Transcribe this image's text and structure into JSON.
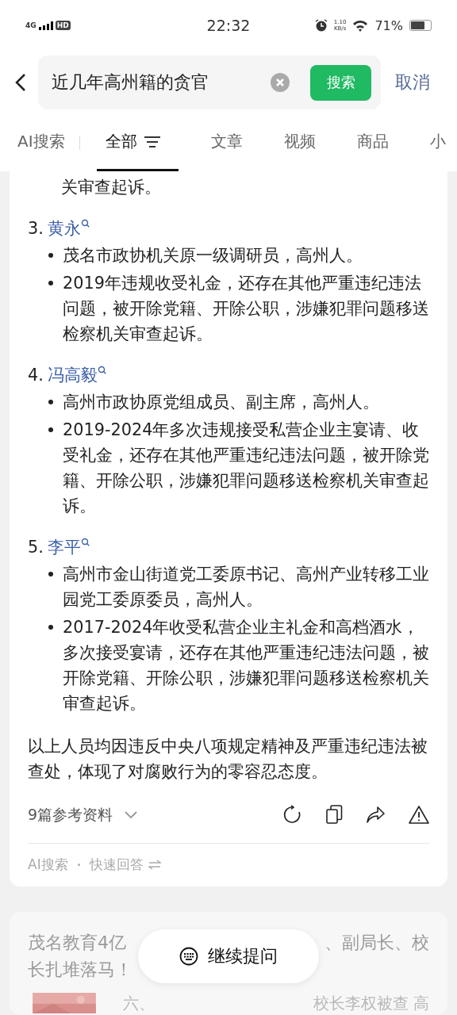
{
  "status_bar": {
    "network": "4G",
    "hd": "HD",
    "time": "22:32",
    "speed": "1.10",
    "speed_unit": "KB/s",
    "battery": "71%"
  },
  "search": {
    "query": "近几年高州籍的贪官",
    "button": "搜索",
    "cancel": "取消"
  },
  "tabs": [
    {
      "label": "AI搜索",
      "selected": false,
      "kind": "plain"
    },
    {
      "label": "全部",
      "selected": true,
      "kind": "filter"
    },
    {
      "label": "文章",
      "selected": false,
      "kind": "plain"
    },
    {
      "label": "视频",
      "selected": false,
      "kind": "plain"
    },
    {
      "label": "商品",
      "selected": false,
      "kind": "plain"
    },
    {
      "label": "小",
      "selected": false,
      "kind": "plain"
    }
  ],
  "answer": {
    "lead_text": "关审查起诉。",
    "items": [
      {
        "number": "3.",
        "name": "黄永",
        "bullets": [
          "茂名市政协机关原一级调研员，高州人。",
          "2019年违规收受礼金，还存在其他严重违纪违法问题，被开除党籍、开除公职，涉嫌犯罪问题移送检察机关审查起诉。"
        ]
      },
      {
        "number": "4.",
        "name": "冯高毅",
        "bullets": [
          "高州市政协原党组成员、副主席，高州人。",
          "2019-2024年多次违规接受私营企业主宴请、收受礼金，还存在其他严重违纪违法问题，被开除党籍、开除公职，涉嫌犯罪问题移送检察机关审查起诉。"
        ]
      },
      {
        "number": "5.",
        "name": "李平",
        "bullets": [
          "高州市金山街道党工委原书记、高州产业转移工业园党工委原委员，高州人。",
          "2017-2024年收受私营企业主礼金和高档酒水，多次接受宴请，还存在其他严重违纪违法问题，被开除党籍、开除公职，涉嫌犯罪问题移送检察机关审查起诉。"
        ]
      }
    ],
    "summary": "以上人员均因违反中央八项规定精神及严重违纪违法被查处，体现了对腐败行为的零容忍态度。",
    "references": "9篇参考资料",
    "footer_source": "AI搜索",
    "footer_mode": "快速回答"
  },
  "result": {
    "title_start": "茂名教育4亿",
    "title_end": "、副局长、校",
    "title_line2": "长扎堆落马！",
    "snippet_start": "六、",
    "snippet_end": "校长李权被查 高"
  },
  "continue_button": "继续提问"
}
